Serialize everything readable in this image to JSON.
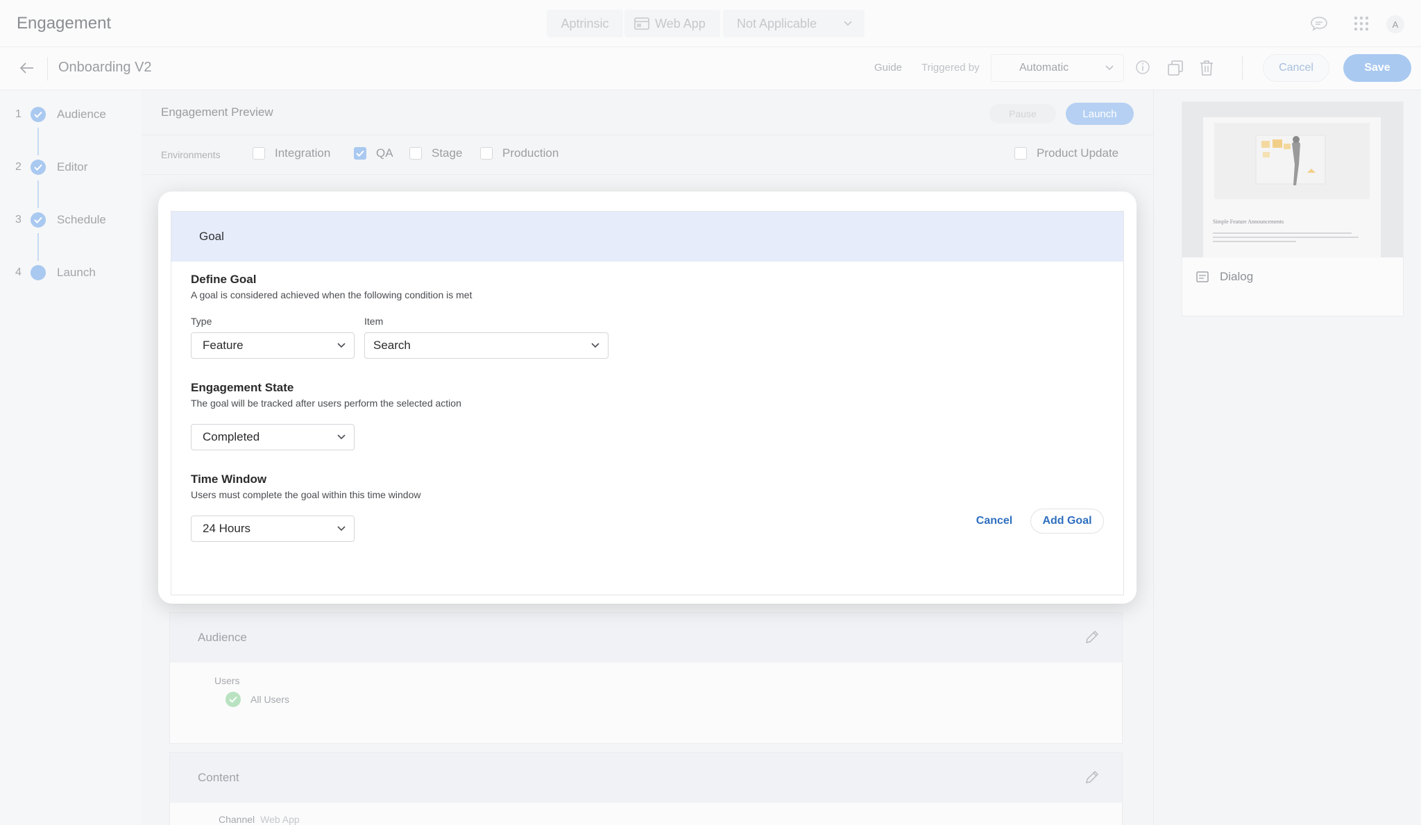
{
  "app": {
    "title": "Engagement",
    "avatar_initial": "A"
  },
  "context": {
    "product": "Aptrinsic",
    "app_type": "Web App",
    "environment_selector": "Not Applicable"
  },
  "header": {
    "title": "Onboarding V2",
    "guide_label": "Guide",
    "triggered_by_label": "Triggered by",
    "trigger_value": "Automatic",
    "cancel_label": "Cancel",
    "save_label": "Save"
  },
  "steps": [
    {
      "num": "1",
      "label": "Audience",
      "done": true
    },
    {
      "num": "2",
      "label": "Editor",
      "done": true
    },
    {
      "num": "3",
      "label": "Schedule",
      "done": true
    },
    {
      "num": "4",
      "label": "Launch",
      "done": false
    }
  ],
  "preview": {
    "title": "Engagement Preview",
    "pause_label": "Pause",
    "launch_label": "Launch",
    "env_label": "Environments",
    "envs": [
      {
        "label": "Integration",
        "checked": false
      },
      {
        "label": "QA",
        "checked": true
      },
      {
        "label": "Stage",
        "checked": false
      },
      {
        "label": "Production",
        "checked": false
      }
    ],
    "product_update_label": "Product Update"
  },
  "cards": {
    "audience_title": "Audience",
    "users_label": "Users",
    "all_users": "All Users",
    "content_title": "Content",
    "channel_label": "Channel",
    "channel_value": "Web App"
  },
  "thumbnail": {
    "heading": "Simple Feature Announcements",
    "type_label": "Dialog"
  },
  "goal_modal": {
    "title": "Goal",
    "define_title": "Define Goal",
    "define_desc": "A goal is considered achieved when the following condition is met",
    "type_label": "Type",
    "type_value": "Feature",
    "item_label": "Item",
    "item_value": "Search",
    "state_title": "Engagement State",
    "state_desc": "The goal will be tracked after users perform the selected action",
    "state_value": "Completed",
    "window_title": "Time Window",
    "window_desc": "Users must complete the goal within this time window",
    "window_value": "24 Hours",
    "cancel_label": "Cancel",
    "add_label": "Add Goal"
  },
  "colors": {
    "accent": "#2e6fbf",
    "step_dot": "#a9c9f0",
    "modal_header": "#e6ecfa"
  }
}
